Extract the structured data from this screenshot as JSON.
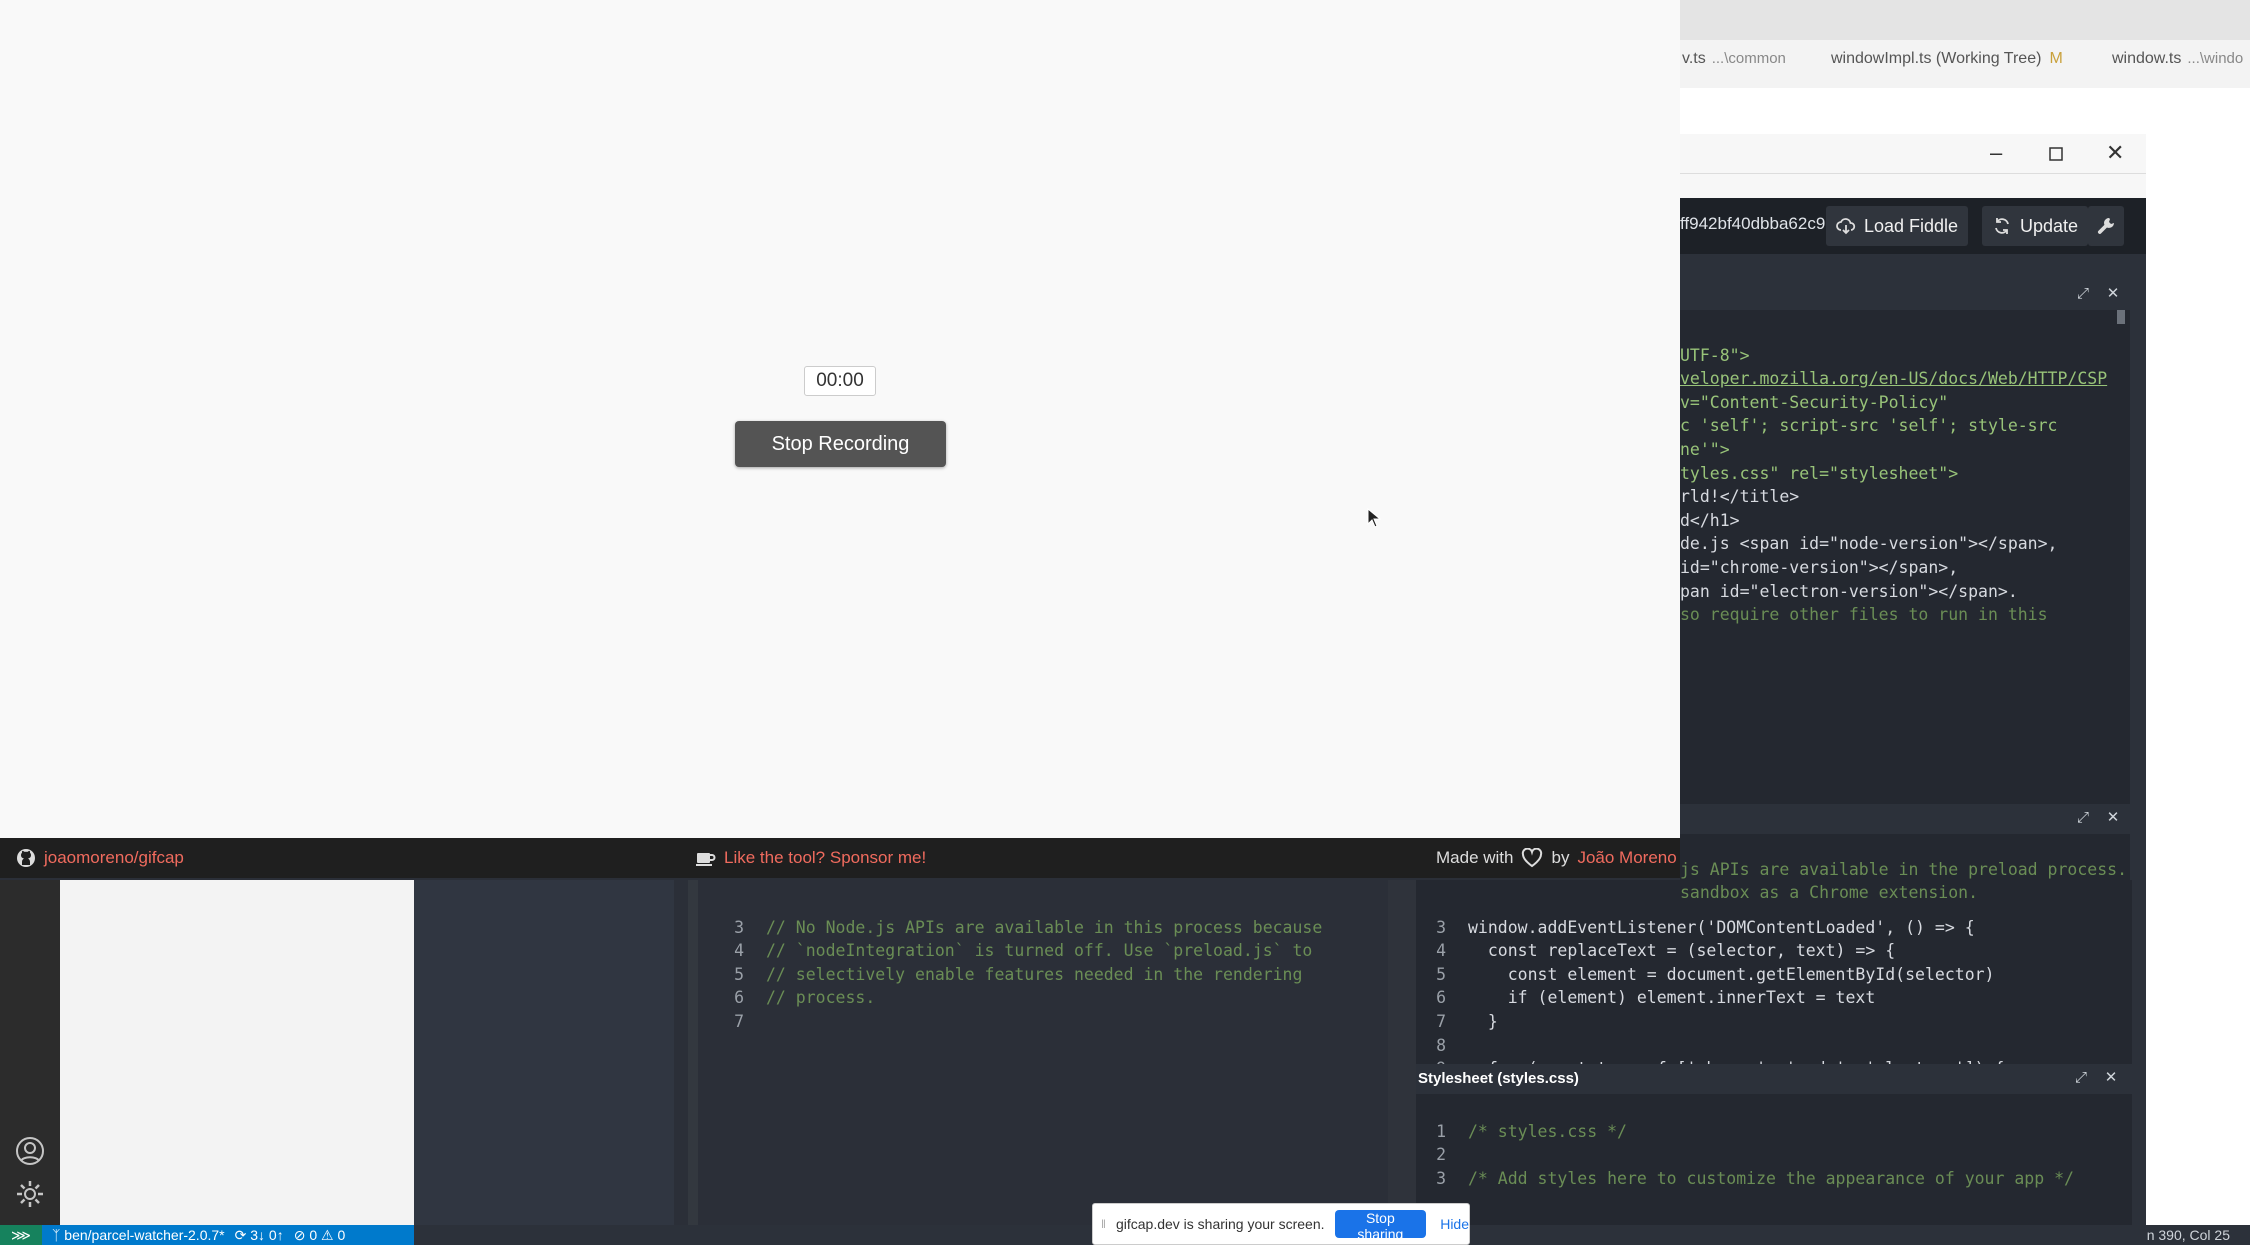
{
  "vscode": {
    "tabs": [
      {
        "name": "v.ts",
        "path": "...\\common",
        "modified": ""
      },
      {
        "name": "windowImpl.ts (Working Tree)",
        "path": "",
        "modified": "M"
      },
      {
        "name": "window.ts",
        "path": "...\\windo",
        "modified": ""
      }
    ],
    "status": {
      "remote_icon": "remote-icon",
      "branch": "ben/parcel-watcher-2.0.7*",
      "sync": "3↓ 0↑",
      "errors": "0",
      "warnings": "0",
      "cursor_position": "n 390, Col 25"
    }
  },
  "fiddle": {
    "gist_id": "ff942bf40dbba62c9",
    "load_label": "Load Fiddle",
    "update_label": "Update",
    "html_lines": [
      "",
      "",
      "UTF-8\">",
      "veloper.mozilla.org/en-US/docs/Web/HTTP/CSP",
      "",
      "v=\"Content-Security-Policy\"",
      "c 'self'; script-src 'self'; style-src",
      "ne'\">",
      "tyles.css\" rel=\"stylesheet\">",
      "rld!</title>",
      "",
      "",
      "d</h1>",
      "de.js <span id=\"node-version\"></span>,",
      "id=\"chrome-version\"></span>,",
      "pan id=\"electron-version\"></span>.",
      "",
      "so require other files to run in this"
    ],
    "preload_lines_top": [
      "js APIs are available in the preload process.",
      "sandbox as a Chrome extension."
    ],
    "preload_lines": [
      {
        "n": "3",
        "text": "window.addEventListener('DOMContentLoaded', () => {"
      },
      {
        "n": "4",
        "text": "  const replaceText = (selector, text) => {"
      },
      {
        "n": "5",
        "text": "    const element = document.getElementById(selector)"
      },
      {
        "n": "6",
        "text": "    if (element) element.innerText = text"
      },
      {
        "n": "7",
        "text": "  }"
      },
      {
        "n": "8",
        "text": ""
      },
      {
        "n": "9",
        "text": "  for (const type of ['chrome', 'node', 'electron']) {"
      }
    ],
    "stylesheet_title": "Stylesheet (styles.css)",
    "stylesheet_lines": [
      {
        "n": "1",
        "text": "/* styles.css */"
      },
      {
        "n": "2",
        "text": ""
      },
      {
        "n": "3",
        "text": "/* Add styles here to customize the appearance of your app */"
      }
    ],
    "renderer_lines": [
      {
        "n": "3",
        "text": "// No Node.js APIs are available in this process because"
      },
      {
        "n": "4",
        "text": "// `nodeIntegration` is turned off. Use `preload.js` to"
      },
      {
        "n": "5",
        "text": "// selectively enable features needed in the rendering"
      },
      {
        "n": "6",
        "text": "// process."
      },
      {
        "n": "7",
        "text": ""
      }
    ]
  },
  "gifcap": {
    "timer": "00:00",
    "stop_label": "Stop Recording",
    "repo_link": "joaomoreno/gifcap",
    "sponsor_link": "Like the tool? Sponsor me!",
    "made_with": "Made with",
    "by": "by",
    "author": "João Moreno"
  },
  "share_bar": {
    "text": "gifcap.dev is sharing your screen.",
    "stop_label": "Stop sharing",
    "hide_label": "Hide"
  }
}
